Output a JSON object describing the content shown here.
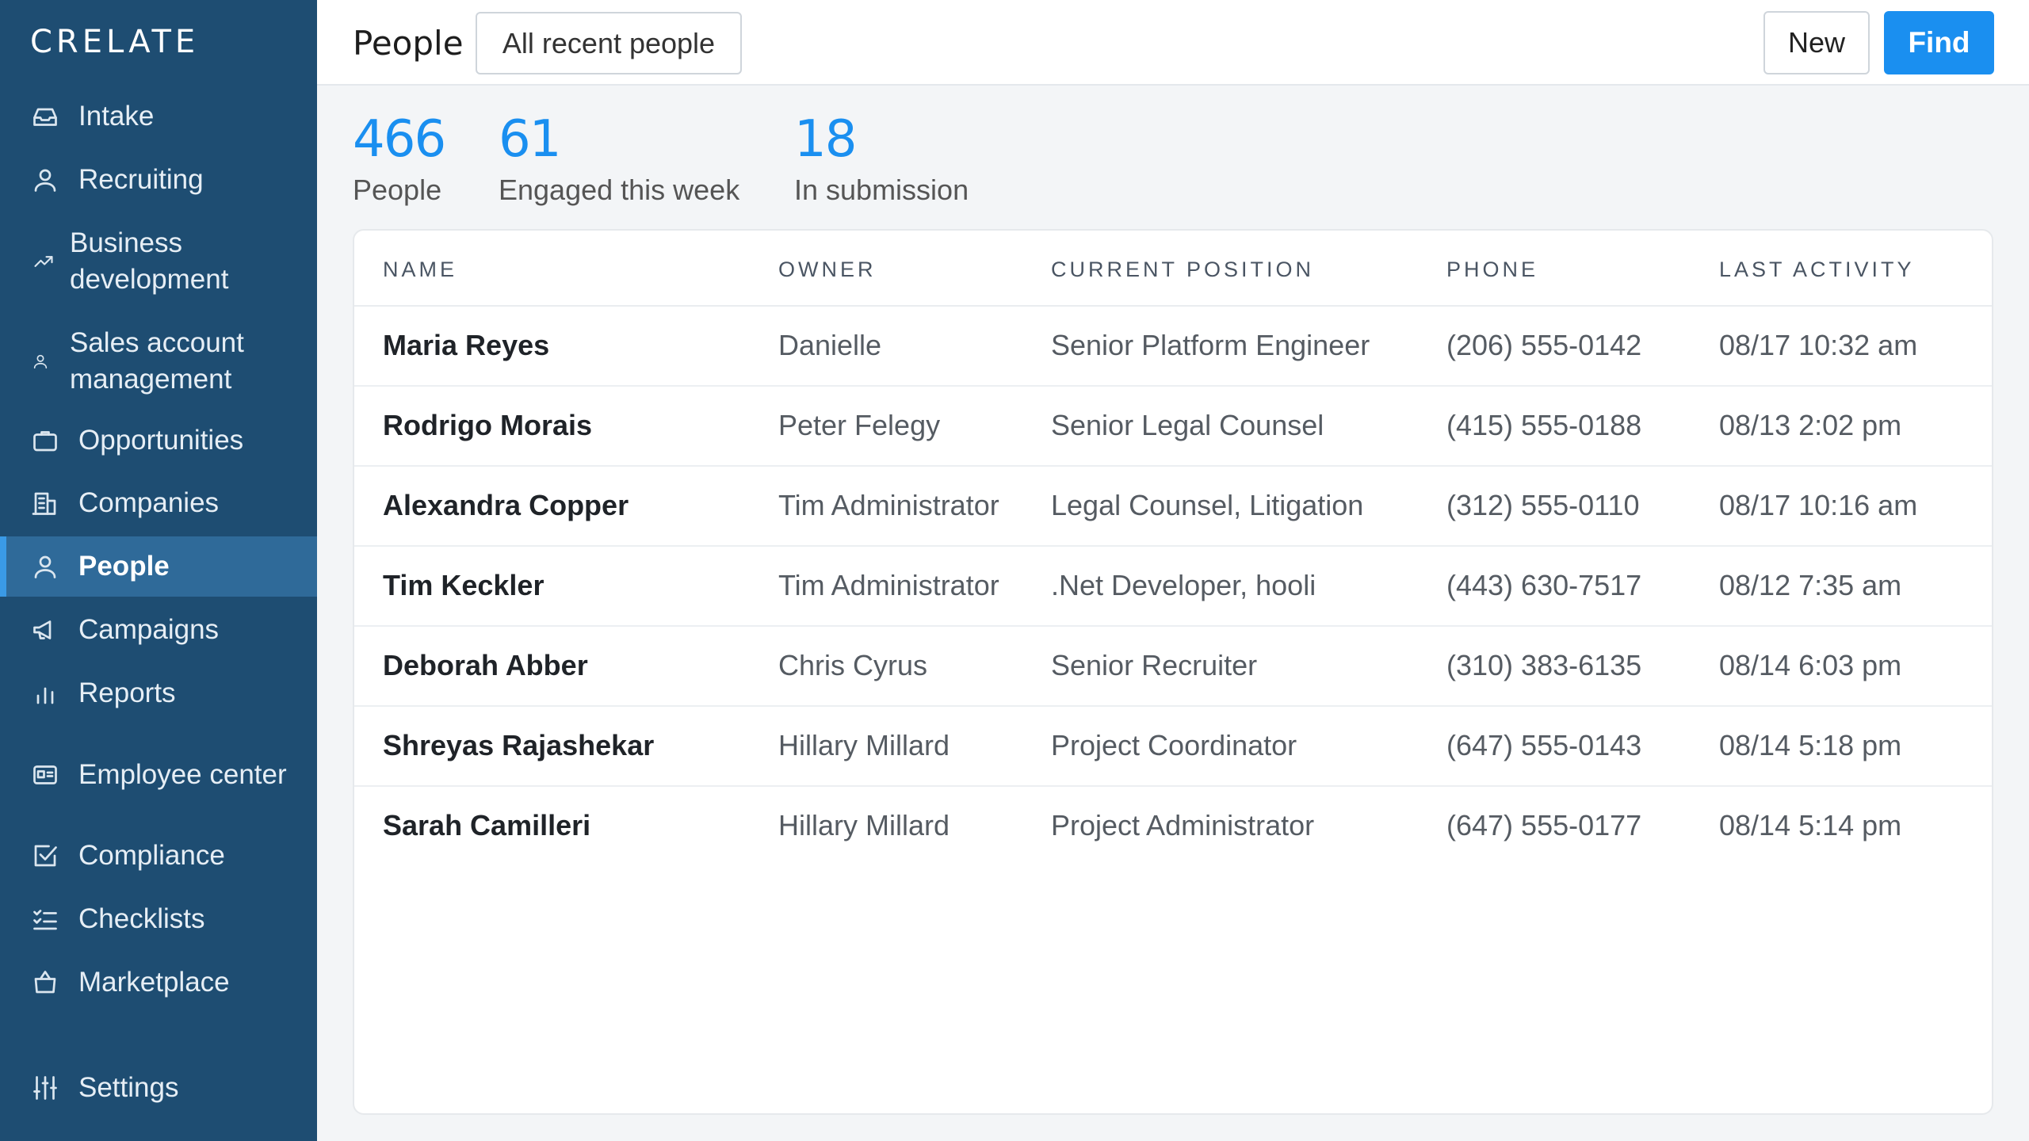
{
  "app": {
    "logo": "CRELATE"
  },
  "sidebar": {
    "items": [
      {
        "label": "Intake",
        "icon": "inbox-icon"
      },
      {
        "label": "Recruiting",
        "icon": "person-icon"
      },
      {
        "label": "Business development",
        "icon": "trend-up-icon"
      },
      {
        "label": "Sales account management",
        "icon": "person-small-icon"
      },
      {
        "label": "Opportunities",
        "icon": "briefcase-icon"
      },
      {
        "label": "Companies",
        "icon": "building-icon"
      },
      {
        "label": "People",
        "icon": "person-icon",
        "active": true
      },
      {
        "label": "Campaigns",
        "icon": "megaphone-icon"
      },
      {
        "label": "Reports",
        "icon": "bar-chart-icon"
      },
      {
        "label": "Employee center",
        "icon": "id-card-icon"
      },
      {
        "label": "Compliance",
        "icon": "checkbox-icon"
      },
      {
        "label": "Checklists",
        "icon": "checklist-icon"
      },
      {
        "label": "Marketplace",
        "icon": "shopping-bag-icon"
      }
    ],
    "settings": {
      "label": "Settings",
      "icon": "sliders-icon"
    }
  },
  "header": {
    "title": "People",
    "filter_label": "All recent people",
    "new_label": "New",
    "find_label": "Find"
  },
  "stats": [
    {
      "value": "466",
      "caption": "People"
    },
    {
      "value": "61",
      "caption": "Engaged this week"
    },
    {
      "value": "18",
      "caption": "In submission"
    }
  ],
  "table": {
    "columns": [
      "NAME",
      "OWNER",
      "CURRENT POSITION",
      "PHONE",
      "LAST ACTIVITY"
    ],
    "rows": [
      [
        "Maria Reyes",
        "Danielle",
        "Senior Platform Engineer",
        "(206) 555-0142",
        "08/17 10:32 am"
      ],
      [
        "Rodrigo Morais",
        "Peter Felegy",
        "Senior Legal Counsel",
        "(415) 555-0188",
        "08/13 2:02 pm"
      ],
      [
        "Alexandra Copper",
        "Tim Administrator",
        "Legal Counsel, Litigation",
        "(312) 555-0110",
        "08/17 10:16 am"
      ],
      [
        "Tim Keckler",
        "Tim Administrator",
        ".Net Developer, hooli",
        "(443) 630-7517",
        "08/12 7:35 am"
      ],
      [
        "Deborah Abber",
        "Chris Cyrus",
        "Senior Recruiter",
        "(310) 383-6135",
        "08/14 6:03 pm"
      ],
      [
        "Shreyas Rajashekar",
        "Hillary Millard",
        "Project Coordinator",
        "(647) 555-0143",
        "08/14 5:18 pm"
      ],
      [
        "Sarah Camilleri",
        "Hillary Millard",
        "Project Administrator",
        "(647) 555-0177",
        "08/14 5:14 pm"
      ]
    ]
  },
  "colors": {
    "sidebar": "#1e4d72",
    "sidebar_active": "#2f6a99",
    "accent": "#1a8ff0"
  }
}
